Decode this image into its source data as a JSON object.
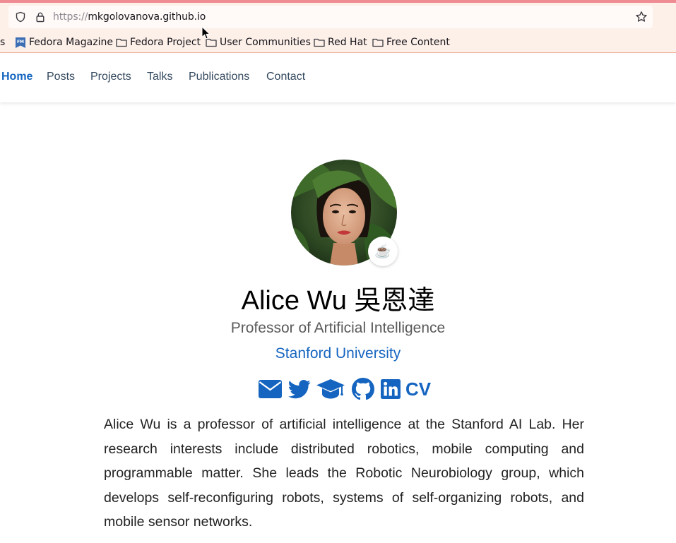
{
  "browser": {
    "url_scheme": "https://",
    "url_host": "mkgolovanova.github.io",
    "bookmarks": {
      "partial": "s",
      "items": [
        {
          "label": "Fedora Magazine",
          "icon": "fedora-magazine-icon"
        },
        {
          "label": "Fedora Project",
          "icon": "folder-icon"
        },
        {
          "label": "User Communities",
          "icon": "folder-icon"
        },
        {
          "label": "Red Hat",
          "icon": "folder-icon"
        },
        {
          "label": "Free Content",
          "icon": "folder-icon"
        }
      ]
    },
    "colors": {
      "toolbar_bg": "#fdf0e9",
      "accent_line": "#ef8c93"
    }
  },
  "nav": {
    "items": [
      {
        "label": "Home",
        "active": true
      },
      {
        "label": "Posts"
      },
      {
        "label": "Projects"
      },
      {
        "label": "Talks"
      },
      {
        "label": "Publications"
      },
      {
        "label": "Contact"
      }
    ]
  },
  "profile": {
    "name": "Alice Wu 吳恩達",
    "role": "Professor of Artificial Intelligence",
    "organization": "Stanford University",
    "status_emoji": "☕️",
    "social": [
      {
        "icon": "envelope-icon"
      },
      {
        "icon": "twitter-icon"
      },
      {
        "icon": "graduation-cap-icon"
      },
      {
        "icon": "github-icon"
      },
      {
        "icon": "linkedin-icon"
      },
      {
        "icon": "cv-icon",
        "label": "CV"
      }
    ],
    "bio": "Alice Wu is a professor of artificial intelligence at the Stanford AI Lab. Her research interests include distributed robotics, mobile computing and programmable matter. She leads the Robotic Neurobiology group, which develops self-reconfiguring robots, systems of self-organizing robots, and mobile sensor networks."
  },
  "theme": {
    "link_color": "#1565c0",
    "nav_text_color": "#34495e"
  }
}
